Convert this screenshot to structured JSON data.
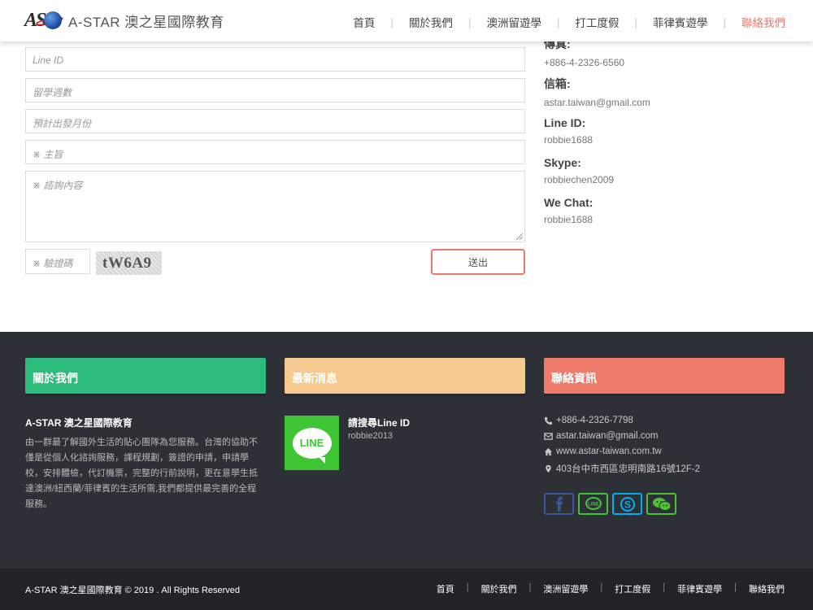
{
  "header": {
    "brand_mark": "AS",
    "brand_name": "A-STAR 澳之星國際教育",
    "nav": [
      {
        "label": "首頁"
      },
      {
        "label": "關於我們"
      },
      {
        "label": "澳洲留遊學"
      },
      {
        "label": "打工度假"
      },
      {
        "label": "菲律賓遊學"
      },
      {
        "label": "聯絡我們"
      }
    ]
  },
  "form": {
    "line_id_placeholder": "Line ID",
    "weeks_placeholder": "留學週數",
    "depart_month_placeholder": "預計出發月份",
    "subject_placeholder": "※ 主旨",
    "message_placeholder": "※ 諮詢內容",
    "captcha_placeholder": "※ 驗證碼",
    "captcha_text": "tW6A9",
    "submit_label": "送出"
  },
  "contact_info": {
    "fax_label": "傳真:",
    "fax_value": "+886-4-2326-6560",
    "email_label": "信箱:",
    "email_value": "astar.taiwan@gmail.com",
    "line_label": "Line ID:",
    "line_value": "robbie1688",
    "skype_label": "Skype:",
    "skype_value": "robbiechen2009",
    "wechat_label": "We Chat:",
    "wechat_value": "robbie1688"
  },
  "footer": {
    "about_heading": "關於我們",
    "news_heading": "最新消息",
    "contact_heading": "聯絡資訊",
    "about_title": "A-STAR 澳之星國際教育",
    "about_text": "由一群最了解國外生活的貼心團隊為您服務。台灣的協助不僅是從個人化諮詢服務，課程規劃，簽證的申請，申請學校，安排體檢，代訂機票，完整的行前說明，更在意學生抵達澳洲/紐西蘭/菲律賓的生活所需,我們都提供最完善的全程服務。",
    "news_title": "請搜尋Line ID",
    "news_sub": "robbie2013",
    "news_logo_text": "LINE",
    "phone": "+886-4-2326-7798",
    "email": "astar.taiwan@gmail.com",
    "website": "www.astar-taiwan.com.tw",
    "address": "403台中市西區忠明南路16號12F-2",
    "social": [
      {
        "icon": "facebook-icon",
        "color": "#3b5998"
      },
      {
        "icon": "line-icon",
        "color": "#3ec534"
      },
      {
        "icon": "skype-icon",
        "color": "#00aff0"
      },
      {
        "icon": "wechat-icon",
        "color": "#4fc134"
      }
    ],
    "colors": {
      "about": "#2dbb7c",
      "news": "#f6c98f",
      "contact": "#ef7b6b",
      "bg": "#2d3036"
    }
  },
  "bottom": {
    "copyright": "A-STAR 澳之星國際教育 © 2019 . All Rights Reserved",
    "nav": [
      "首頁",
      "關於我們",
      "澳洲留遊學",
      "打工度假",
      "菲律賓遊學",
      "聯絡我們"
    ]
  }
}
